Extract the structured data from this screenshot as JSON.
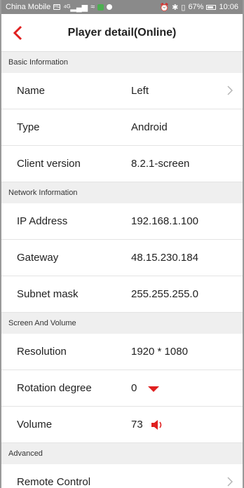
{
  "status_bar": {
    "carrier": "China Mobile",
    "battery": "67%",
    "time": "10:06"
  },
  "header": {
    "title": "Player detail(Online)",
    "back_icon": "chevron-left-icon",
    "accent_color": "#e02020"
  },
  "sections": {
    "basic": {
      "title": "Basic Information",
      "name_label": "Name",
      "name_value": "Left",
      "type_label": "Type",
      "type_value": "Android",
      "client_label": "Client version",
      "client_value": "8.2.1-screen"
    },
    "network": {
      "title": "Network Information",
      "ip_label": "IP Address",
      "ip_value": "192.168.1.100",
      "gateway_label": "Gateway",
      "gateway_value": "48.15.230.184",
      "subnet_label": "Subnet mask",
      "subnet_value": "255.255.255.0"
    },
    "screen": {
      "title": "Screen And Volume",
      "resolution_label": "Resolution",
      "resolution_value": "1920 * 1080",
      "rotation_label": "Rotation degree",
      "rotation_value": "0",
      "volume_label": "Volume",
      "volume_value": "73"
    },
    "advanced": {
      "title": "Advanced",
      "remote_label": "Remote Control"
    }
  }
}
